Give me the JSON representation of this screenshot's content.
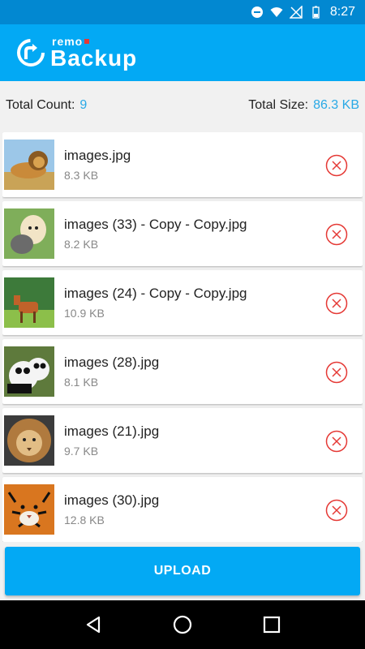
{
  "status_bar": {
    "time": "8:27"
  },
  "app": {
    "logo_small": "remo",
    "logo_big": "Backup"
  },
  "summary": {
    "count_label": "Total Count:",
    "count_value": "9",
    "size_label": "Total Size:",
    "size_value": "86.3 KB"
  },
  "files": [
    {
      "name": "images.jpg",
      "size": "8.3 KB",
      "thumb": "lion"
    },
    {
      "name": "images (33) - Copy - Copy.jpg",
      "size": "8.2 KB",
      "thumb": "puppy-kitten"
    },
    {
      "name": "images (24) - Copy - Copy.jpg",
      "size": "10.9 KB",
      "thumb": "antelope"
    },
    {
      "name": "images (28).jpg",
      "size": "8.1 KB",
      "thumb": "pandas"
    },
    {
      "name": "images (21).jpg",
      "size": "9.7 KB",
      "thumb": "lion-face"
    },
    {
      "name": "images (30).jpg",
      "size": "12.8 KB",
      "thumb": "tiger"
    }
  ],
  "upload": {
    "label": "UPLOAD"
  },
  "colors": {
    "primary": "#03a9f4",
    "primary_dark": "#0288d1",
    "accent_text": "#29a9e6",
    "remove": "#e53935"
  }
}
